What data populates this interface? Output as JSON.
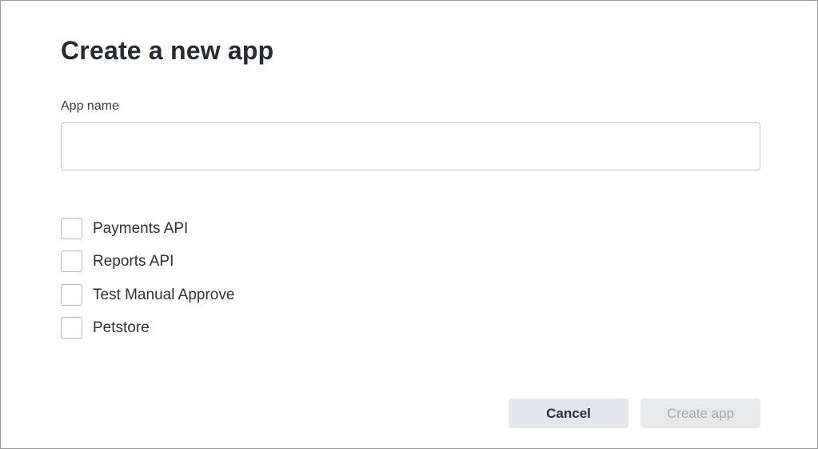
{
  "dialog": {
    "title": "Create a new app",
    "app_name_label": "App name",
    "app_name_value": "",
    "app_name_placeholder": ""
  },
  "apis": [
    {
      "label": "Payments API",
      "checked": false
    },
    {
      "label": "Reports API",
      "checked": false
    },
    {
      "label": "Test Manual Approve",
      "checked": false
    },
    {
      "label": "Petstore",
      "checked": false
    }
  ],
  "actions": {
    "cancel_label": "Cancel",
    "create_label": "Create app",
    "create_enabled": false
  },
  "colors": {
    "border": "#9a9a9a",
    "input_border": "#c6c8cc",
    "cancel_bg": "#e3e6ea",
    "create_disabled_bg": "#e8e9eb",
    "create_disabled_text": "#a4a8ae"
  }
}
